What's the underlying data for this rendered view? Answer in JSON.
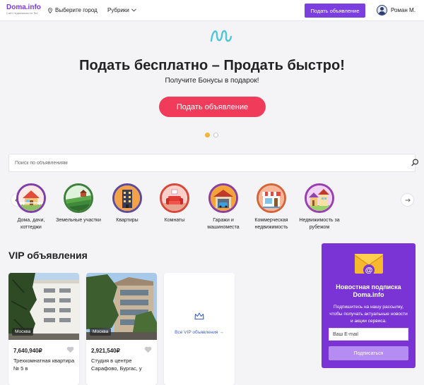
{
  "header": {
    "logo_name": "Doma.info",
    "logo_tagline": "Сайт недвижимости №1",
    "city_label": "Выберите город",
    "rubrics_label": "Рубрики",
    "post_button": "Подать объявление",
    "user_name": "Роман М."
  },
  "hero": {
    "title": "Подать бесплатно – Продать быстро!",
    "subtitle": "Получите Бонусы в подарок!",
    "button": "Подать объявление",
    "slide_active": 1,
    "slide_count": 2
  },
  "search": {
    "placeholder": "Поиск по объявлениям"
  },
  "categories": [
    {
      "label": "Дома, дачи, коттеджи",
      "icon": "house-icon"
    },
    {
      "label": "Земельные участки",
      "icon": "land-icon"
    },
    {
      "label": "Квартиры",
      "icon": "apartment-building-icon"
    },
    {
      "label": "Комнаты",
      "icon": "room-sofa-icon"
    },
    {
      "label": "Гаражи и машиноместа",
      "icon": "garage-icon"
    },
    {
      "label": "Коммерческая недвижимость",
      "icon": "shop-icon"
    },
    {
      "label": "Недвижимость за рубежом",
      "icon": "abroad-houses-icon"
    }
  ],
  "vip": {
    "title": "VIP объявления",
    "listings": [
      {
        "city": "Москва",
        "price": "7,640,940₽",
        "title": "Трехкомнатная квартира № 5 в"
      },
      {
        "city": "Москва",
        "price": "2,921,540₽",
        "title": "Студия в центре Сарафово, Бургас, у"
      }
    ],
    "all_link": "Все VIP объявления →"
  },
  "subscribe": {
    "title": "Новостная подписка Doma.info",
    "text": "Подпишитесь на нашу рассылку, чтобы получать актуальные новости и акции сервиса.",
    "email_placeholder": "Ваш E-mail",
    "button": "Подписаться"
  },
  "colors": {
    "accent_purple": "#7b3fe0",
    "hero_button_red": "#f03c5a",
    "slider_active_dot": "#f4b63a",
    "link_blue": "#3a62c8",
    "category_ring": "#7e3fa8"
  }
}
